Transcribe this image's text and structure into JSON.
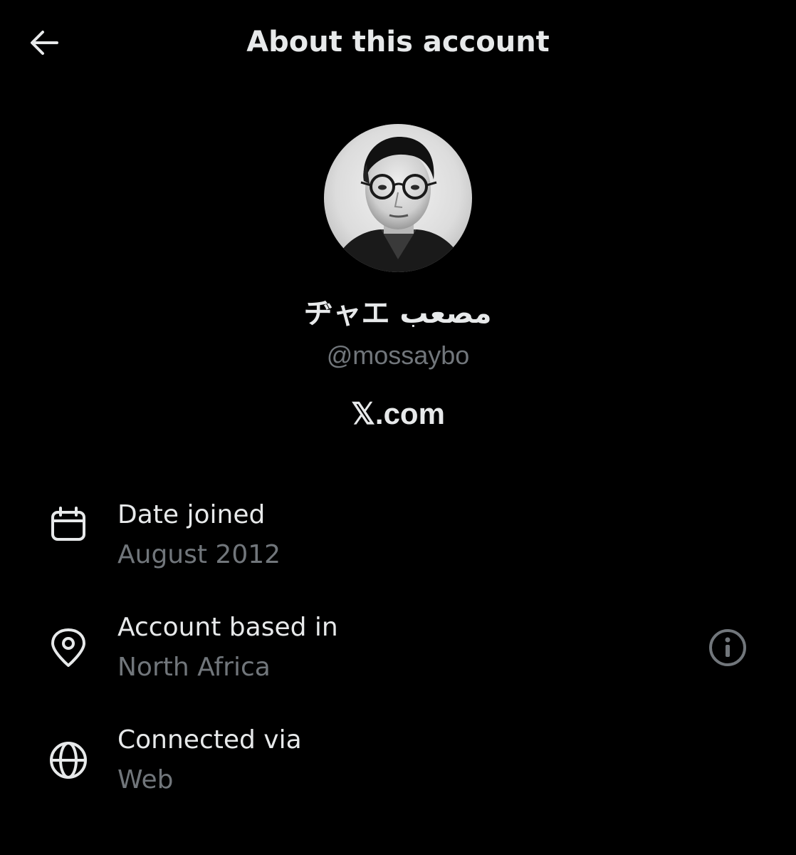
{
  "header": {
    "title": "About this account",
    "back_icon": "arrow-left-icon"
  },
  "profile": {
    "display_name": "ヂャエ مصعب",
    "handle": "@mossaybo",
    "site": "𝕏.com"
  },
  "details": {
    "date_joined": {
      "icon": "calendar-icon",
      "label": "Date joined",
      "value": "August 2012"
    },
    "account_based_in": {
      "icon": "location-pin-icon",
      "label": "Account based in",
      "value": "North Africa",
      "info_icon": "info-icon"
    },
    "connected_via": {
      "icon": "globe-icon",
      "label": "Connected via",
      "value": "Web"
    }
  },
  "colors": {
    "background": "#000000",
    "primary_text": "#e7e9ea",
    "secondary_text": "#71767b"
  }
}
